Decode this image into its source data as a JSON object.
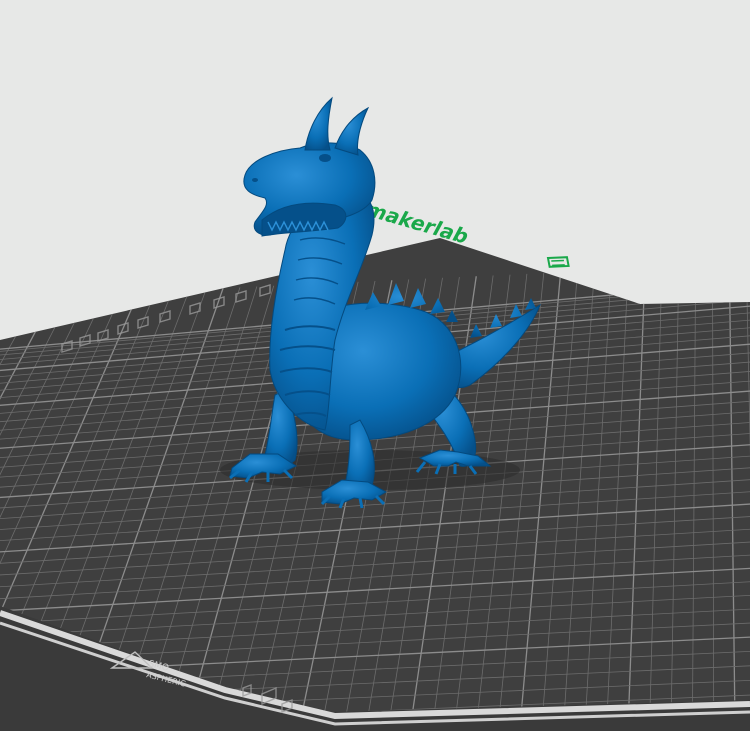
{
  "scene": {
    "brand_label": "makerlab",
    "plate_label_line1": "SMO",
    "plate_label_line2": "ASPHERIC"
  },
  "colors": {
    "background": "#e7e8e7",
    "plate": "#3f3f3f",
    "grid_minor": "#6c6c6c",
    "grid_major": "#8c8c8c",
    "plate_edge": "#d9d9d9",
    "brand": "#1aa84a",
    "model": "#0a6fb6"
  },
  "icons": {
    "model": "dragon-model",
    "brand": "makerlab-logo-icon",
    "plate": "build-plate"
  }
}
